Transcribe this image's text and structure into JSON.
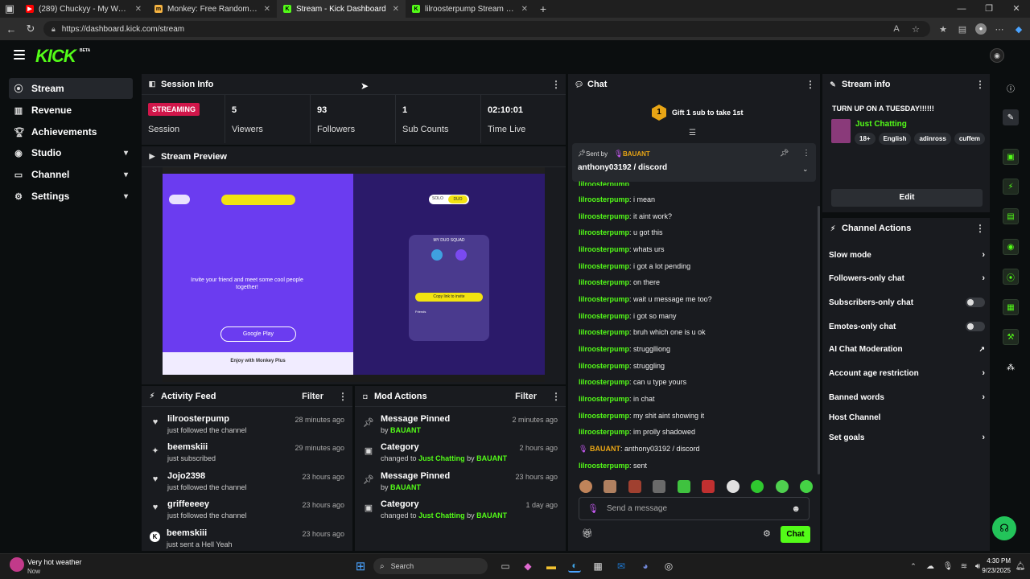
{
  "browser": {
    "tabs": [
      {
        "title": "(289) Chuckyy - My World (Officia",
        "fav": "youtube-icon",
        "color": "#ff0000"
      },
      {
        "title": "Monkey: Free Random Video Cha",
        "fav": "monkey-icon",
        "color": "#f5b342"
      },
      {
        "title": "Stream - Kick Dashboard",
        "fav": "kick-icon",
        "color": "#53fc18"
      },
      {
        "title": "lilroosterpump Stream - Watch Li",
        "fav": "kick-icon",
        "color": "#53fc18"
      }
    ],
    "url": "https://dashboard.kick.com/stream"
  },
  "brand": {
    "logo": "KICK",
    "beta": "BETA",
    "accent": "#53fc18"
  },
  "sidebar": {
    "items": [
      {
        "label": "Stream",
        "icon": "stream-icon"
      },
      {
        "label": "Revenue",
        "icon": "revenue-icon"
      },
      {
        "label": "Achievements",
        "icon": "trophy-icon"
      },
      {
        "label": "Studio",
        "icon": "studio-icon"
      },
      {
        "label": "Channel",
        "icon": "channel-icon"
      },
      {
        "label": "Settings",
        "icon": "gear-icon"
      }
    ]
  },
  "session": {
    "title": "Session Info",
    "badge": "STREAMING",
    "session_label": "Session",
    "stats": [
      {
        "value": "5",
        "label": "Viewers"
      },
      {
        "value": "93",
        "label": "Followers"
      },
      {
        "value": "1",
        "label": "Sub Counts"
      },
      {
        "value": "02:10:01",
        "label": "Time Live"
      }
    ]
  },
  "preview": {
    "title": "Stream Preview",
    "invite": "Invite your friend and meet some cool people together!",
    "getit": "Google Play",
    "monkeyplus": "Enjoy with Monkey Plus",
    "solo": "SOLO",
    "duo": "DUO",
    "squad": "MY DUO SQUAD",
    "copy": "Copy link to invite",
    "friends": "Friends"
  },
  "activity": {
    "title": "Activity Feed",
    "filter": "Filter",
    "rows": [
      {
        "name": "lilroosterpump",
        "sub": "just followed the channel",
        "time": "28 minutes ago",
        "icon": "heart-icon"
      },
      {
        "name": "beemskiii",
        "sub": "just subscribed",
        "time": "29 minutes ago",
        "icon": "sparkle-icon"
      },
      {
        "name": "Jojo2398",
        "sub": "just followed the channel",
        "time": "23 hours ago",
        "icon": "heart-icon"
      },
      {
        "name": "griffeeeey",
        "sub": "just followed the channel",
        "time": "23 hours ago",
        "icon": "heart-icon"
      },
      {
        "name": "beemskiii",
        "sub": "just sent a Hell Yeah",
        "time": "23 hours ago",
        "icon": "kick-icon"
      }
    ]
  },
  "mod": {
    "title": "Mod Actions",
    "filter": "Filter",
    "rows": [
      {
        "name": "Message Pinned",
        "pre": "by",
        "hl1": "BAUANT",
        "mid": "",
        "hl2": "",
        "time": "2 minutes ago",
        "icon": "pin-icon"
      },
      {
        "name": "Category",
        "pre": "changed to",
        "hl1": "Just Chatting",
        "mid": "by",
        "hl2": "BAUANT",
        "time": "2 hours ago",
        "icon": "category-icon"
      },
      {
        "name": "Message Pinned",
        "pre": "by",
        "hl1": "BAUANT",
        "mid": "",
        "hl2": "",
        "time": "23 hours ago",
        "icon": "pin-icon"
      },
      {
        "name": "Category",
        "pre": "changed to",
        "hl1": "Just Chatting",
        "mid": "by",
        "hl2": "BAUANT",
        "time": "1 day ago",
        "icon": "category-icon"
      }
    ]
  },
  "chat": {
    "title": "Chat",
    "gift": "Gift 1 sub to take 1st",
    "gift_num": "1",
    "pinned": {
      "sent_by": "Sent by",
      "user": "BAUANT",
      "text": "anthony03192 / discord"
    },
    "partial": "lilroosterpump",
    "messages": [
      {
        "user": "lilroosterpump",
        "text": "i mean"
      },
      {
        "user": "lilroosterpump",
        "text": "it aint work?"
      },
      {
        "user": "lilroosterpump",
        "text": "u got this"
      },
      {
        "user": "lilroosterpump",
        "text": "whats urs"
      },
      {
        "user": "lilroosterpump",
        "text": "i got a lot pending"
      },
      {
        "user": "lilroosterpump",
        "text": "on there"
      },
      {
        "user": "lilroosterpump",
        "text": "wait u message me too?"
      },
      {
        "user": "lilroosterpump",
        "text": "i got so many"
      },
      {
        "user": "lilroosterpump",
        "text": "bruh which one is u ok"
      },
      {
        "user": "lilroosterpump",
        "text": "strugglliong"
      },
      {
        "user": "lilroosterpump",
        "text": "struggling"
      },
      {
        "user": "lilroosterpump",
        "text": "can u type yours"
      },
      {
        "user": "lilroosterpump",
        "text": "in chat"
      },
      {
        "user": "lilroosterpump",
        "text": "my shit aint showing it"
      },
      {
        "user": "lilroosterpump",
        "text": "im prolly shadowed"
      },
      {
        "user": "BAUANT",
        "text": "anthony03192 / discord"
      },
      {
        "user": "lilroosterpump",
        "text": "sent"
      }
    ],
    "placeholder": "Send a message",
    "send": "Chat"
  },
  "streaminfo": {
    "title": "Stream info",
    "stream_title": "TURN UP ON A TUESDAY!!!!!!",
    "category": "Just Chatting",
    "tags": [
      "18+",
      "English",
      "adinross",
      "cuffem"
    ],
    "edit": "Edit"
  },
  "actions": {
    "title": "Channel Actions",
    "items": [
      {
        "label": "Slow mode",
        "type": "arrow"
      },
      {
        "label": "Followers-only chat",
        "type": "arrow"
      },
      {
        "label": "Subscribers-only chat",
        "type": "toggle"
      },
      {
        "label": "Emotes-only chat",
        "type": "toggle"
      },
      {
        "label": "AI Chat Moderation",
        "type": "external"
      },
      {
        "label": "Account age restriction",
        "type": "arrow"
      },
      {
        "label": "Banned words",
        "type": "arrow"
      },
      {
        "label": "Host Channel",
        "type": "none"
      },
      {
        "label": "Set goals",
        "type": "arrow"
      }
    ]
  },
  "taskbar": {
    "weather_title": "Very hot weather",
    "weather_sub": "Now",
    "search": "Search",
    "time": "4:30 PM",
    "date": "9/23/2025"
  }
}
